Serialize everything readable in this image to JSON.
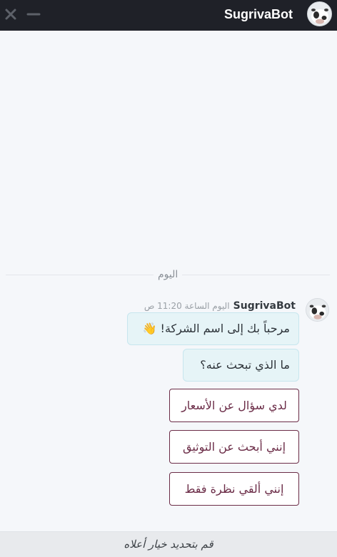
{
  "header": {
    "title": "SugrivaBot",
    "close_icon": "close-icon",
    "minimize_icon": "minimize-icon"
  },
  "chat": {
    "day_label": "اليوم",
    "author": "SugrivaBot",
    "timestamp": "اليوم الساعة 11:20 ص",
    "messages": [
      {
        "text": "مرحباً بك إلى اسم الشركة!",
        "emoji": "👋"
      },
      {
        "text": "ما الذي تبحث عنه؟"
      }
    ],
    "options": [
      {
        "label": "لدي سؤال عن الأسعار"
      },
      {
        "label": "إنني أبحث عن التوثيق"
      },
      {
        "label": "إنني ألقي نظرة فقط"
      }
    ]
  },
  "composer": {
    "placeholder": "قم بتحديد خيار أعلاه"
  },
  "colors": {
    "header_bg": "#1f2128",
    "bubble_bg": "#e6f4f7",
    "option_border": "#6b2c47",
    "background": "#f5f7fa"
  }
}
